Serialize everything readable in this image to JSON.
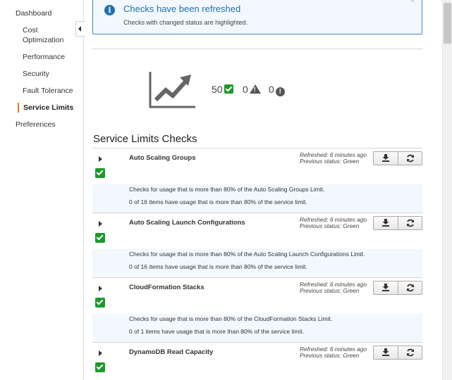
{
  "sidebar": {
    "items": [
      {
        "label": "Dashboard"
      },
      {
        "label": "Cost\nOptimization"
      },
      {
        "label": "Performance"
      },
      {
        "label": "Security"
      },
      {
        "label": "Fault Tolerance"
      },
      {
        "label": "Service Limits"
      },
      {
        "label": "Preferences"
      }
    ]
  },
  "alert": {
    "title": "Checks have been refreshed",
    "text": "Checks with changed status are highlighted.",
    "close": "×"
  },
  "summary": {
    "ok_count": "50",
    "warning_count": "0",
    "error_count": "0"
  },
  "section": {
    "title": "Service Limits Checks"
  },
  "checks": [
    {
      "name": "Auto Scaling Groups",
      "refreshed": "Refreshed: 6 minutes ago",
      "previous_status": "Previous status: Green",
      "description": "Checks for usage that is more than 80% of the Auto Scaling Groups Limit.",
      "result": "0 of 16 items have usage that is more than 80% of the service limit."
    },
    {
      "name": "Auto Scaling Launch Configurations",
      "refreshed": "Refreshed: 6 minutes ago",
      "previous_status": "Previous status: Green",
      "description": "Checks for usage that is more than 80% of the Auto Scaling Launch Configurations Limit.",
      "result": "0 of 16 items have usage that is more than 80% of the service limit."
    },
    {
      "name": "CloudFormation Stacks",
      "refreshed": "Refreshed: 6 minutes ago",
      "previous_status": "Previous status: Green",
      "description": "Checks for usage that is more than 80% of the CloudFormation Stacks Limit.",
      "result": "0 of 1 items have usage that is more than 80% of the service limit."
    },
    {
      "name": "DynamoDB Read Capacity",
      "refreshed": "Refreshed: 6 minutes ago",
      "previous_status": "Previous status: Green"
    }
  ],
  "colors": {
    "accent": "#1f6fb2",
    "ok": "#1a9b2a",
    "active_marker": "#e07b2a",
    "highlight_bg": "#f2f8fd"
  },
  "icons": {
    "alert": "info-icon",
    "summary": "trending-chart-icon",
    "ok": "check-icon",
    "warning": "warning-icon",
    "error": "error-icon",
    "download": "download-icon",
    "refresh": "refresh-icon",
    "expand": "caret-right-icon"
  }
}
